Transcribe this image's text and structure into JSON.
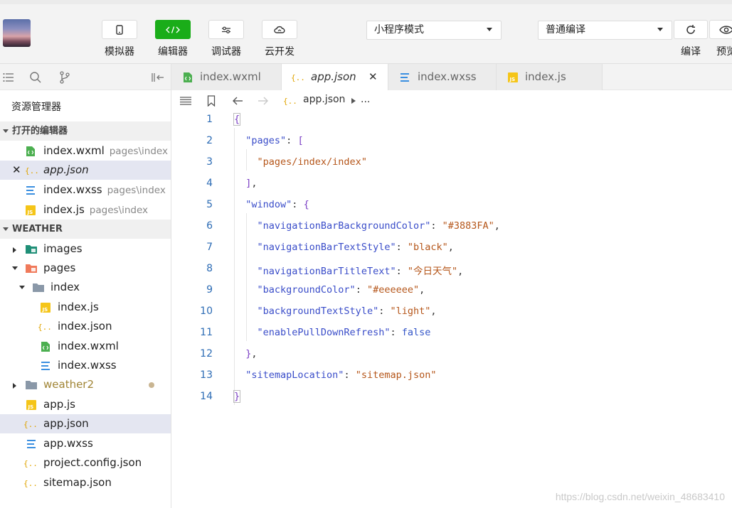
{
  "toolbar": {
    "simulator": "模拟器",
    "editor": "编辑器",
    "debugger": "调试器",
    "cloud": "云开发",
    "mode_select": "小程序模式",
    "compile_select": "普通编译",
    "compile": "编译",
    "preview": "预览"
  },
  "sidebar": {
    "title": "资源管理器",
    "open_editors_header": "打开的编辑器",
    "open_editors": [
      {
        "name": "index.wxml",
        "path": "pages\\index",
        "icon": "wxml-icon"
      },
      {
        "name": "app.json",
        "path": "",
        "icon": "json-icon"
      },
      {
        "name": "index.wxss",
        "path": "pages\\index",
        "icon": "wxss-icon"
      },
      {
        "name": "index.js",
        "path": "pages\\index",
        "icon": "js-icon"
      }
    ],
    "project_header": "WEATHER",
    "tree": [
      {
        "name": "images",
        "icon": "images-folder-icon"
      },
      {
        "name": "pages",
        "icon": "pages-folder-icon"
      },
      {
        "name": "index",
        "icon": "folder-icon"
      },
      {
        "name": "index.js",
        "icon": "js-icon"
      },
      {
        "name": "index.json",
        "icon": "json-icon"
      },
      {
        "name": "index.wxml",
        "icon": "wxml-icon"
      },
      {
        "name": "index.wxss",
        "icon": "wxss-icon"
      },
      {
        "name": "weather2",
        "icon": "folder-icon"
      },
      {
        "name": "app.js",
        "icon": "js-icon"
      },
      {
        "name": "app.json",
        "icon": "json-icon"
      },
      {
        "name": "app.wxss",
        "icon": "wxss-icon"
      },
      {
        "name": "project.config.json",
        "icon": "json-icon"
      },
      {
        "name": "sitemap.json",
        "icon": "json-icon"
      }
    ]
  },
  "tabs": [
    {
      "label": "index.wxml"
    },
    {
      "label": "app.json"
    },
    {
      "label": "index.wxss"
    },
    {
      "label": "index.js"
    }
  ],
  "breadcrumb": {
    "file": "app.json",
    "more": "..."
  },
  "code": {
    "line_numbers": [
      "1",
      "2",
      "3",
      "4",
      "5",
      "6",
      "7",
      "8",
      "9",
      "10",
      "11",
      "12",
      "13",
      "14"
    ],
    "lines": [
      "{",
      "  \"pages\": [",
      "    \"pages/index/index\"",
      "  ],",
      "  \"window\": {",
      "    \"navigationBarBackgroundColor\": \"#3883FA\",",
      "    \"navigationBarTextStyle\": \"black\",",
      "    \"navigationBarTitleText\": \"今日天气\",",
      "    \"backgroundColor\": \"#eeeeee\",",
      "    \"backgroundTextStyle\": \"light\",",
      "    \"enablePullDownRefresh\": false",
      "  },",
      "  \"sitemapLocation\": \"sitemap.json\"",
      "}"
    ]
  },
  "watermark": "https://blog.csdn.net/weixin_48683410",
  "colors": {
    "accent_green": "#1aad19",
    "selection": "#e4e6f1",
    "line_number": "#2d6cb5",
    "json_key": "#3a4dc9",
    "json_string": "#b5561a"
  }
}
